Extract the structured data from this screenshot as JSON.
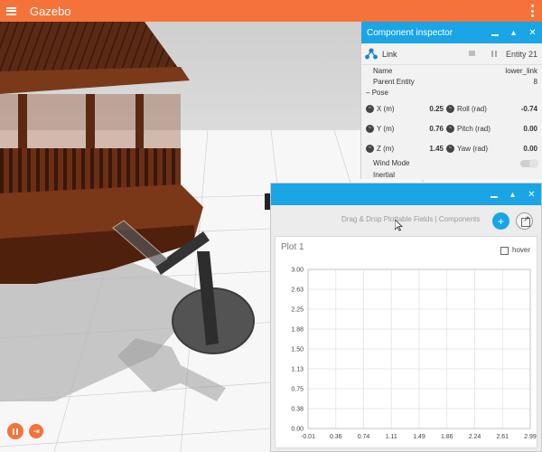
{
  "app": {
    "title": "Gazebo",
    "accent": "#f5733a"
  },
  "topbar": {
    "menu_icon": "hamburger-icon",
    "more_icon": "kebab-icon"
  },
  "inspector": {
    "title": "Component inspector",
    "link_label": "Link",
    "entity_label": "Entity 21",
    "name_label": "Name",
    "name_value": "lower_link",
    "parent_label": "Parent Entity",
    "parent_value": "8",
    "pose_label": "Pose",
    "x_label": "X (m)",
    "x_value": "0.25",
    "y_label": "Y (m)",
    "y_value": "0.76",
    "z_label": "Z (m)",
    "z_value": "1.45",
    "roll_label": "Roll (rad)",
    "roll_value": "-0.74",
    "pitch_label": "Pitch (rad)",
    "pitch_value": "0.00",
    "yaw_label": "Yaw (rad)",
    "yaw_value": "0.00",
    "wind_label": "Wind Mode",
    "wind_on": false,
    "inertial_label": "Inertial"
  },
  "plotting": {
    "drag_hint": "Drag & Drop Plottable Fields | Components",
    "add_label": "+",
    "plot_title": "Plot 1",
    "hover_label": "hover",
    "hover_checked": false
  },
  "chart_data": {
    "type": "line",
    "title": "Plot 1",
    "xlabel": "",
    "ylabel": "",
    "xticks": [
      "-0.01",
      "0.36",
      "0.74",
      "1.11",
      "1.49",
      "1.86",
      "2.24",
      "2.61",
      "2.99"
    ],
    "yticks": [
      "0.00",
      "0.38",
      "0.75",
      "1.13",
      "1.50",
      "1.88",
      "2.25",
      "2.63",
      "3.00"
    ],
    "xlim": [
      -0.01,
      2.99
    ],
    "ylim": [
      0,
      3
    ],
    "grid": true,
    "series": []
  },
  "colors": {
    "accent": "#f5733a",
    "panel_header": "#19a5e6"
  }
}
